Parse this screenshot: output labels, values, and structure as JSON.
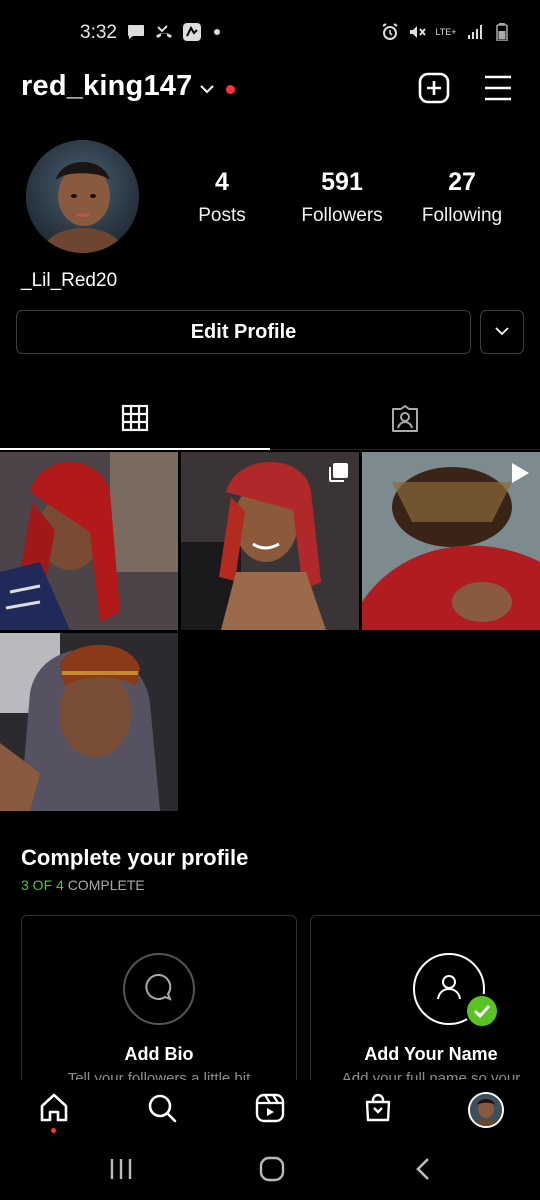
{
  "status_bar": {
    "time": "3:32",
    "left_icons": [
      "message-icon",
      "missed-call-icon",
      "app-notification-icon"
    ],
    "right_icons": [
      "alarm-icon",
      "mute-icon",
      "lte-icon",
      "signal-icon",
      "battery-icon"
    ],
    "network_label": "LTE+"
  },
  "header": {
    "username": "red_king147",
    "accent_color": "#ff3040"
  },
  "profile": {
    "display_name": "_Lil_Red20",
    "stats": [
      {
        "value": "4",
        "label": "Posts"
      },
      {
        "value": "591",
        "label": "Followers"
      },
      {
        "value": "27",
        "label": "Following"
      }
    ],
    "edit_label": "Edit Profile"
  },
  "tabs": [
    {
      "name": "grid",
      "icon": "grid-icon",
      "active": true
    },
    {
      "name": "tagged",
      "icon": "tagged-icon",
      "active": false
    }
  ],
  "posts": [
    {
      "type": "photo",
      "badge": null
    },
    {
      "type": "carousel",
      "badge": "carousel-icon"
    },
    {
      "type": "video",
      "badge": "play-icon"
    },
    {
      "type": "photo",
      "badge": null
    }
  ],
  "complete_profile": {
    "title": "Complete your profile",
    "progress_count": "3 OF 4",
    "progress_label": "COMPLETE",
    "progress_color": "#58c322",
    "cards": [
      {
        "title": "Add Bio",
        "subtitle": "Tell your followers a little bit",
        "icon": "speech-bubble-icon",
        "done": false
      },
      {
        "title": "Add Your Name",
        "subtitle": "Add your full name so your",
        "icon": "user-icon",
        "done": true
      }
    ]
  },
  "bottom_nav": [
    {
      "name": "home",
      "icon": "home-icon",
      "active": true
    },
    {
      "name": "search",
      "icon": "search-icon",
      "active": false
    },
    {
      "name": "reels",
      "icon": "reels-icon",
      "active": false
    },
    {
      "name": "shop",
      "icon": "shop-icon",
      "active": false
    },
    {
      "name": "profile",
      "icon": "profile-avatar",
      "active": false
    }
  ]
}
